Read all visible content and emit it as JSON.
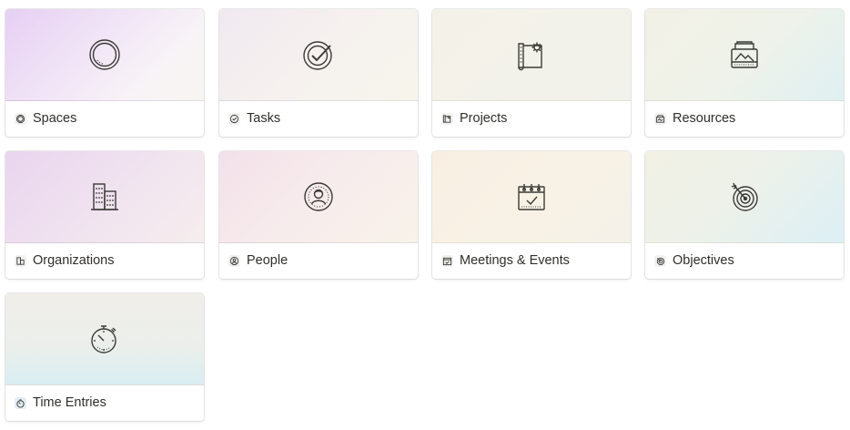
{
  "gallery": {
    "cards": [
      {
        "label": "Spaces",
        "icon": "circle-ring-icon"
      },
      {
        "label": "Tasks",
        "icon": "check-badge-icon"
      },
      {
        "label": "Projects",
        "icon": "blueprint-gear-icon"
      },
      {
        "label": "Resources",
        "icon": "inbox-tray-icon"
      },
      {
        "label": "Organizations",
        "icon": "buildings-icon"
      },
      {
        "label": "People",
        "icon": "person-badge-icon"
      },
      {
        "label": "Meetings & Events",
        "icon": "calendar-check-icon"
      },
      {
        "label": "Objectives",
        "icon": "target-arrow-icon"
      },
      {
        "label": "Time Entries",
        "icon": "stopwatch-icon"
      }
    ]
  }
}
